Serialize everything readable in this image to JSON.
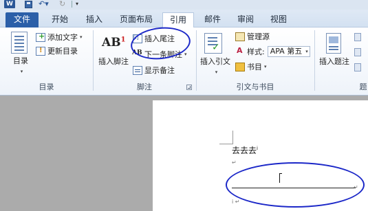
{
  "titlebar": {
    "app_logo": "W",
    "icons": [
      "word-logo",
      "save-icon",
      "undo-icon",
      "redo-icon"
    ]
  },
  "tabs": [
    {
      "label": "文件"
    },
    {
      "label": "开始"
    },
    {
      "label": "插入"
    },
    {
      "label": "页面布局"
    },
    {
      "label": "引用"
    },
    {
      "label": "邮件"
    },
    {
      "label": "审阅"
    },
    {
      "label": "视图"
    }
  ],
  "active_tab": "引用",
  "ribbon": {
    "toc_group": {
      "toc_button": "目录",
      "add_text": "添加文字",
      "update_toc": "更新目录",
      "label": "目录"
    },
    "footnote_group": {
      "insert_footnote": "插入脚注",
      "insert_endnote": "插入尾注",
      "next_footnote": "下一条脚注",
      "show_notes": "显示备注",
      "label": "脚注"
    },
    "citation_group": {
      "insert_citation": "插入引文",
      "manage_sources": "管理源",
      "style_label": "样式:",
      "style_value": "APA 第五",
      "bibliography": "书目",
      "label": "引文与书目"
    },
    "caption_group": {
      "insert_caption": "插入题注",
      "label": "题"
    }
  },
  "document": {
    "text": "去去去",
    "footnote_ref": "i"
  },
  "colors": {
    "file_tab": "#2b5fa8",
    "annotation": "#1c28c8"
  }
}
